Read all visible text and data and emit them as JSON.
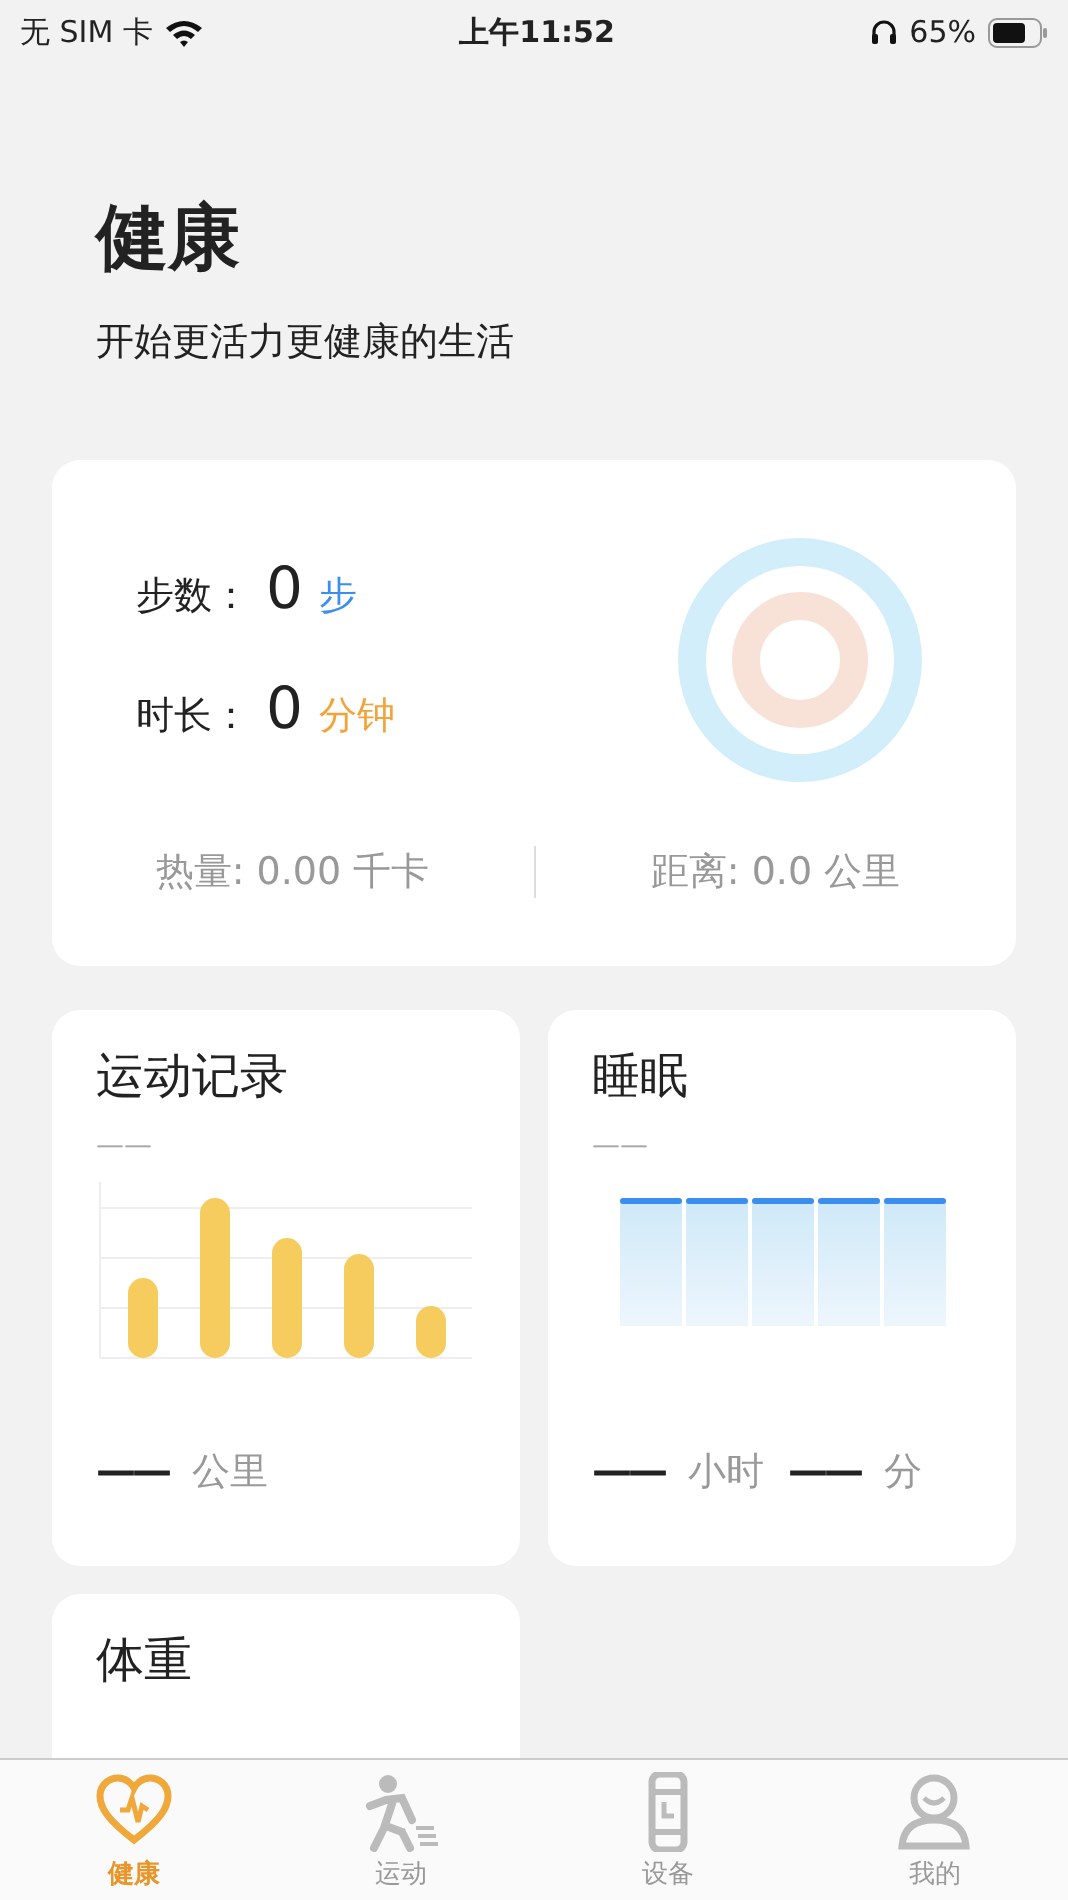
{
  "status_bar": {
    "carrier": "无 SIM 卡",
    "time": "上午11:52",
    "battery": "65%"
  },
  "header": {
    "title": "健康",
    "subtitle": "开始更活力更健康的生活"
  },
  "summary": {
    "metrics": [
      {
        "label": "步数：",
        "value": "0",
        "unit": "步",
        "color": "#3a8ef0"
      },
      {
        "label": "时长：",
        "value": "0",
        "unit": "分钟",
        "color": "#f2a33a"
      }
    ],
    "footer": [
      "热量: 0.00 千卡",
      "距离: 0.0 公里"
    ]
  },
  "cards": [
    {
      "kind": "bars",
      "title": "运动记录",
      "subtitle": "——",
      "readings": [
        {
          "value": "——",
          "unit": "公里"
        }
      ]
    },
    {
      "kind": "sleep",
      "title": "睡眠",
      "subtitle": "——",
      "readings": [
        {
          "value": "——",
          "unit": "小时"
        },
        {
          "value": "——",
          "unit": "分"
        }
      ]
    },
    {
      "kind": "plain",
      "title": "体重"
    }
  ],
  "tabs": [
    {
      "label": "健康",
      "selected": true
    },
    {
      "label": "运动",
      "selected": false
    },
    {
      "label": "设备",
      "selected": false
    },
    {
      "label": "我的",
      "selected": false
    }
  ]
}
